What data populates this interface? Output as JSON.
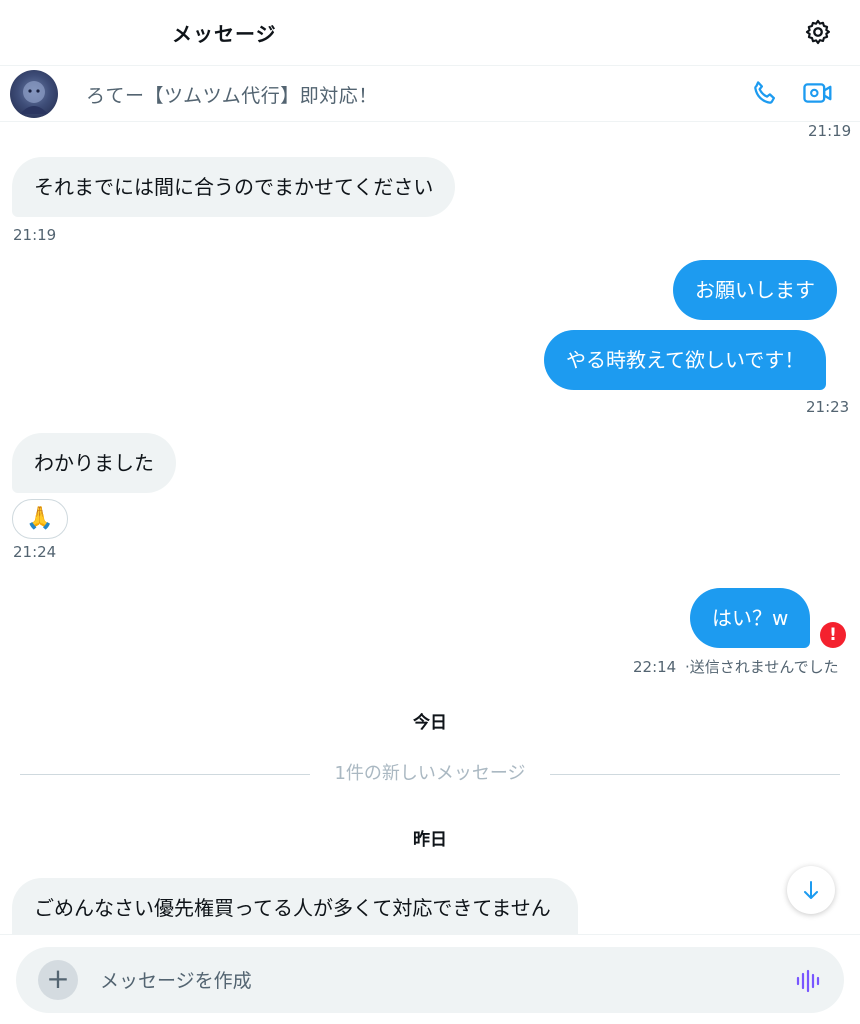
{
  "header": {
    "title": "メッセージ",
    "settings_icon": "gear-icon"
  },
  "conversation": {
    "name": "ろてー【ツムツム代行】即対応！",
    "call_icon": "phone-icon",
    "video_icon": "video-camera-icon"
  },
  "messages": {
    "top_timestamp": "21:19",
    "m1": {
      "text": "それまでには間に合うのでまかせてください",
      "time": "21:19"
    },
    "m2": {
      "text": "お願いします"
    },
    "m3": {
      "text": "やる時教えて欲しいです！",
      "time": "21:23"
    },
    "m4": {
      "text": "わかりました",
      "reaction": "🙏",
      "time": "21:24"
    },
    "m5": {
      "text": "はい？w",
      "time": "22:14",
      "status": "·送信されませんでした",
      "error_mark": "!"
    },
    "day_today": "今日",
    "new_divider": "1件の新しいメッセージ",
    "day_yesterday": "昨日",
    "m6": {
      "text": "ごめんなさい優先権買ってる人が多くて対応できてません"
    }
  },
  "composer": {
    "placeholder": "メッセージを作成",
    "plus_label": "+",
    "voice_icon": "voice-wave-icon"
  },
  "colors": {
    "accent": "#1d9bf0",
    "incoming_bubble": "#eff3f4",
    "error": "#f4212e",
    "voice": "#7856ff"
  }
}
